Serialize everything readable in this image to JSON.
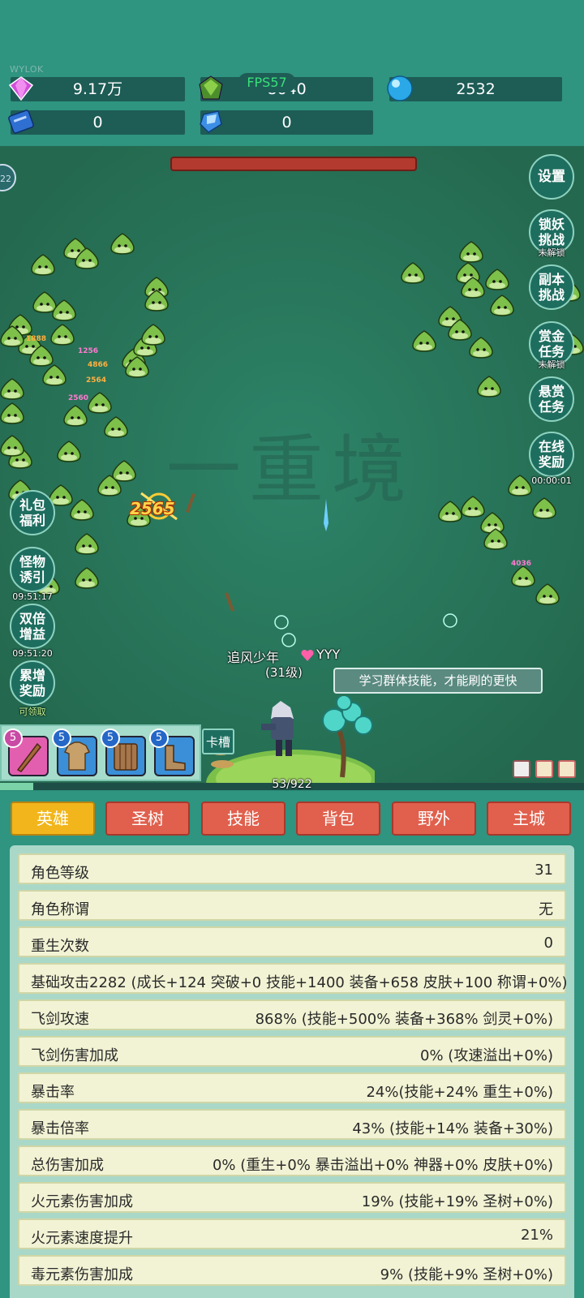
{
  "top": {
    "watermark_text": "WYLOK",
    "fps": "FPS57",
    "resources": [
      {
        "name": "purple-gem",
        "value": "9.17万"
      },
      {
        "name": "green-crystal",
        "value": "8640"
      },
      {
        "name": "blue-orb",
        "value": "2532"
      },
      {
        "name": "blue-book",
        "value": "0"
      },
      {
        "name": "blue-shard",
        "value": "0"
      }
    ]
  },
  "field": {
    "realm_text": "一重境",
    "damage_big": "2565",
    "damage_small": [
      "1256",
      "4866",
      "2564",
      "2560",
      "1888",
      "4036"
    ],
    "player_name": "追风少年",
    "player_level": "(31级)",
    "pet_name": "YYY",
    "tip": "学习群体技能，才能刷的更快",
    "left_badge": "22"
  },
  "right_buttons": [
    {
      "label": "设置",
      "sub": ""
    },
    {
      "label": "锁妖挑战",
      "sub": "未解锁"
    },
    {
      "label": "副本挑战",
      "sub": ""
    },
    {
      "label": "赏金任务",
      "sub": "未解锁"
    },
    {
      "label": "悬赏任务",
      "sub": ""
    },
    {
      "label": "在线奖励",
      "sub": "00:00:01"
    }
  ],
  "left_buttons": [
    {
      "label": "礼包福利",
      "sub": ""
    },
    {
      "label": "怪物诱引",
      "sub": "09:51:17"
    },
    {
      "label": "双倍增益",
      "sub": "09:51:20"
    },
    {
      "label": "累增奖励",
      "sub": "可领取"
    }
  ],
  "equipment": {
    "slots": [
      {
        "item": "wooden-sword",
        "level": "5",
        "color": "#e25fb0"
      },
      {
        "item": "leather-armor",
        "level": "5",
        "color": "#3a8fd8"
      },
      {
        "item": "wooden-shield",
        "level": "5",
        "color": "#3a8fd8"
      },
      {
        "item": "leather-boots",
        "level": "5",
        "color": "#3a8fd8"
      }
    ],
    "card_slot": "卡槽"
  },
  "xp": {
    "text": "53/922",
    "progress": 0.0575
  },
  "tabs": [
    "英雄",
    "圣树",
    "技能",
    "背包",
    "野外",
    "主城"
  ],
  "active_tab": "英雄",
  "stats": [
    {
      "k": "角色等级",
      "v": "31"
    },
    {
      "k": "角色称谓",
      "v": "无"
    },
    {
      "k": "重生次数",
      "v": "0"
    },
    {
      "full": "基础攻击2282 (成长+124 突破+0 技能+1400 装备+658 皮肤+100 称谓+0%)"
    },
    {
      "k": "飞剑攻速",
      "v": "868% (技能+500% 装备+368% 剑灵+0%)"
    },
    {
      "k": "飞剑伤害加成",
      "v": "0% (攻速溢出+0%)"
    },
    {
      "k": "暴击率",
      "v": "24%(技能+24% 重生+0%)"
    },
    {
      "k": "暴击倍率",
      "v": "43% (技能+14% 装备+30%)"
    },
    {
      "k": "总伤害加成",
      "v": "0% (重生+0% 暴击溢出+0% 神器+0% 皮肤+0%)"
    },
    {
      "k": "火元素伤害加成",
      "v": "19% (技能+19% 圣树+0%)"
    },
    {
      "k": "火元素速度提升",
      "v": "21%"
    },
    {
      "k": "毒元素伤害加成",
      "v": "9% (技能+9% 圣树+0%)"
    }
  ]
}
